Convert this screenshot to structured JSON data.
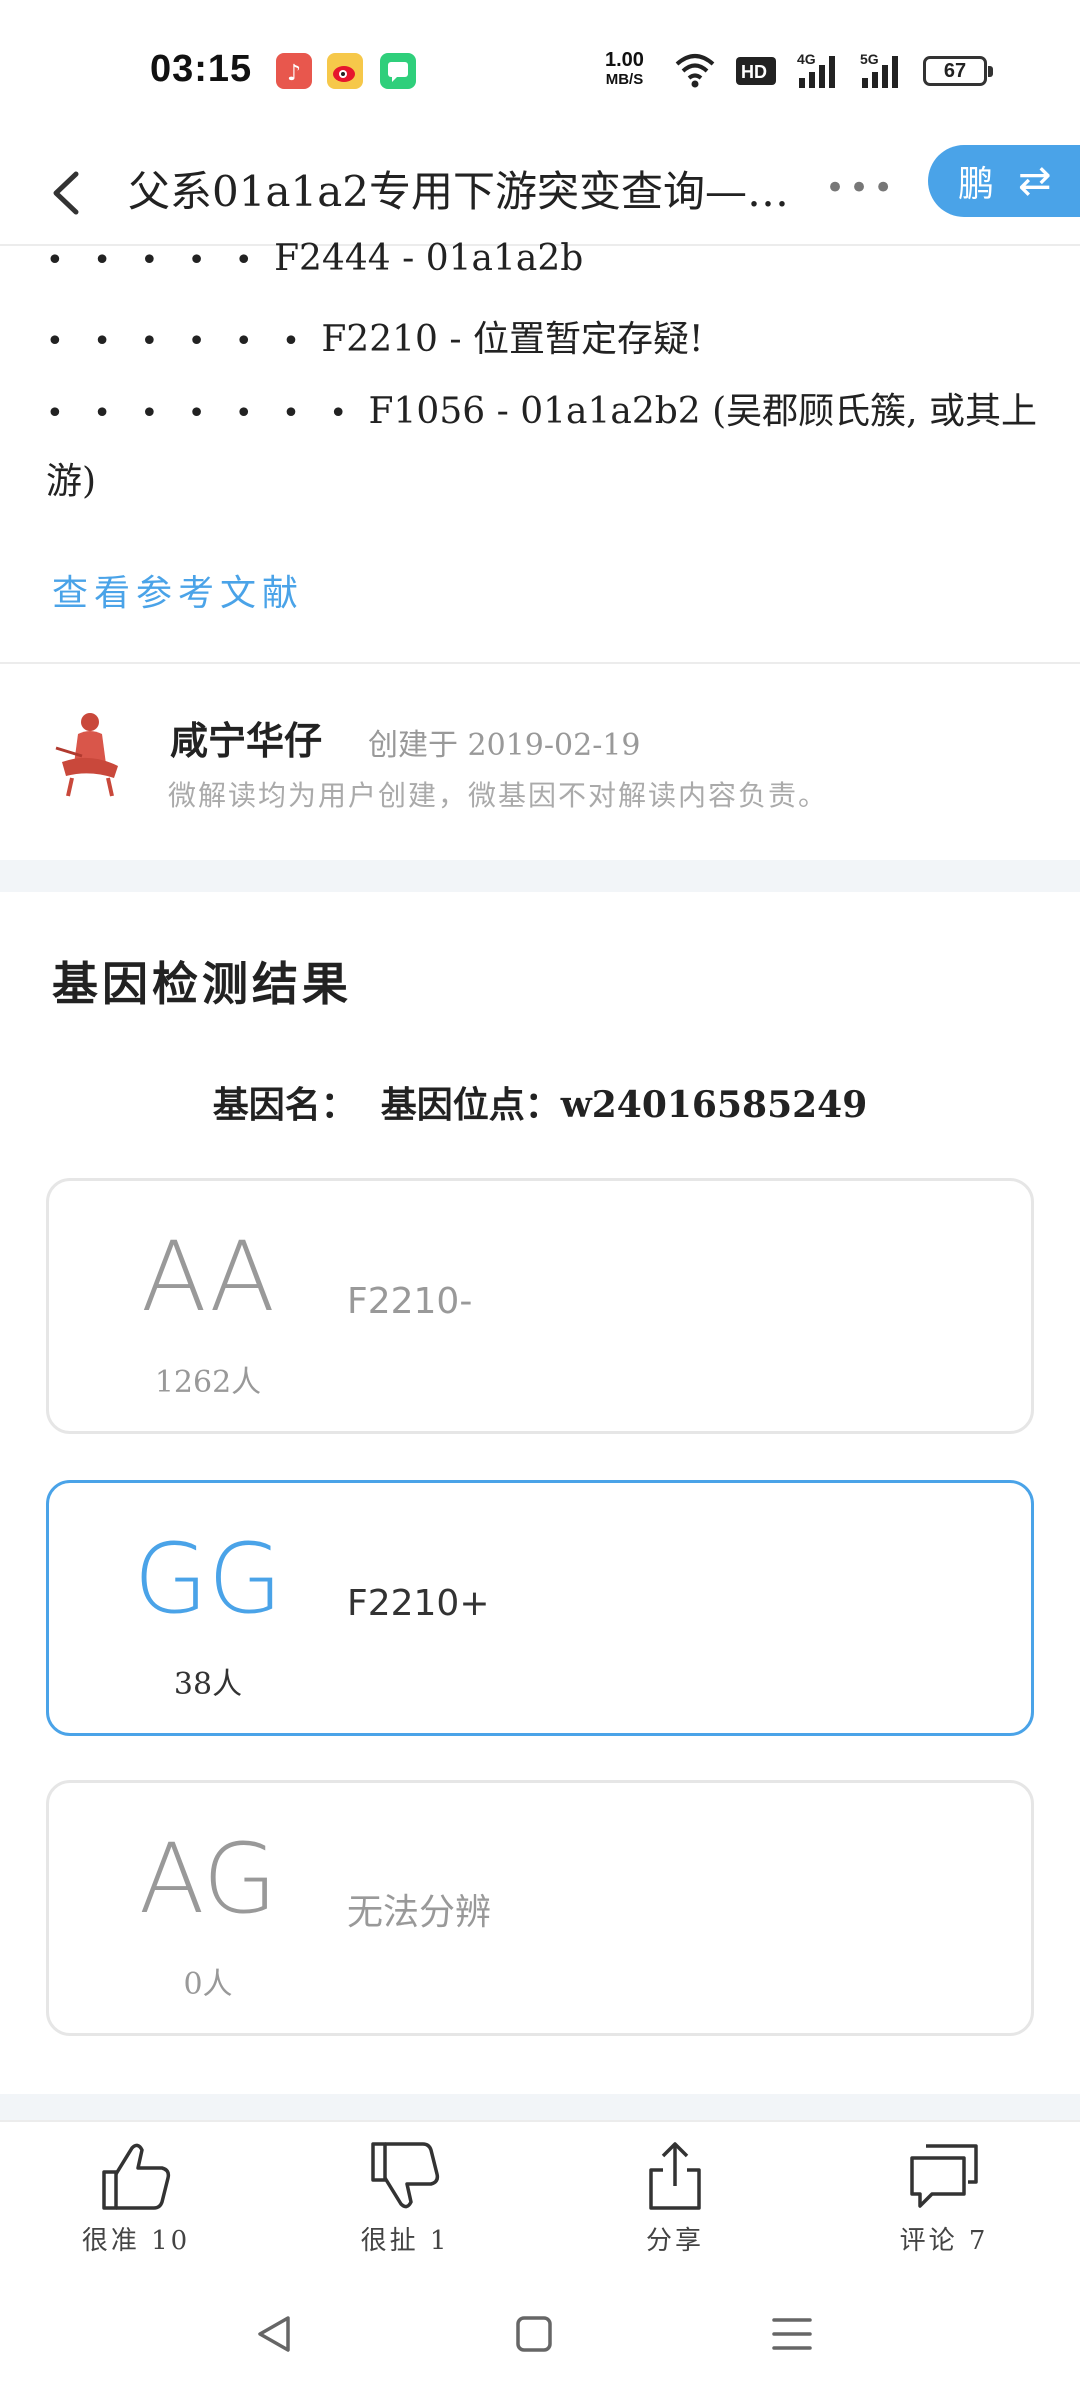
{
  "status_bar": {
    "time": "03:15",
    "net_speed_value": "1.00",
    "net_speed_unit": "MB/S",
    "battery": "67",
    "icons": [
      "music-app-icon",
      "weibo-icon",
      "chat-app-icon",
      "wifi-icon",
      "hd-icon",
      "4g-signal-icon",
      "5g-signal-icon"
    ]
  },
  "header": {
    "title": "父系01a1a2专用下游突变查询—…",
    "more": "•••",
    "user_button": "鹏",
    "swap_icon": "⇄"
  },
  "tree_lines": [
    {
      "dots": "• • • • •",
      "text": "F2444 - 01a1a2b"
    },
    {
      "dots": "• • • • • •",
      "text": "F2210 - 位置暂定存疑!"
    },
    {
      "dots": "• • • • • • •",
      "text": "F1056 - 01a1a2b2 (吴郡顾氏簇, 或其上"
    },
    {
      "dots": "",
      "text": "游)"
    }
  ],
  "reference_link": "查看参考文献",
  "author": {
    "name": "咸宁华仔",
    "created": "创建于 2019-02-19",
    "note": "微解读均为用户创建，微基因不对解读内容负责。"
  },
  "section_title": "基因检测结果",
  "gene_info": {
    "name_label": "基因名：",
    "site_label": "基因位点：w24016585249"
  },
  "results": [
    {
      "genotype": "AA",
      "count": "1262人",
      "desc": "F2210-",
      "selected": false
    },
    {
      "genotype": "GG",
      "count": "38人",
      "desc": "F2210+",
      "selected": true
    },
    {
      "genotype": "AG",
      "count": "0人",
      "desc": "无法分辨",
      "selected": false
    }
  ],
  "actions": {
    "like": "很准 10",
    "dislike": "很扯 1",
    "share": "分享",
    "comment": "评论 7"
  },
  "colors": {
    "accent": "#4aa3e8",
    "muted": "#999999",
    "divider": "#ececec"
  }
}
